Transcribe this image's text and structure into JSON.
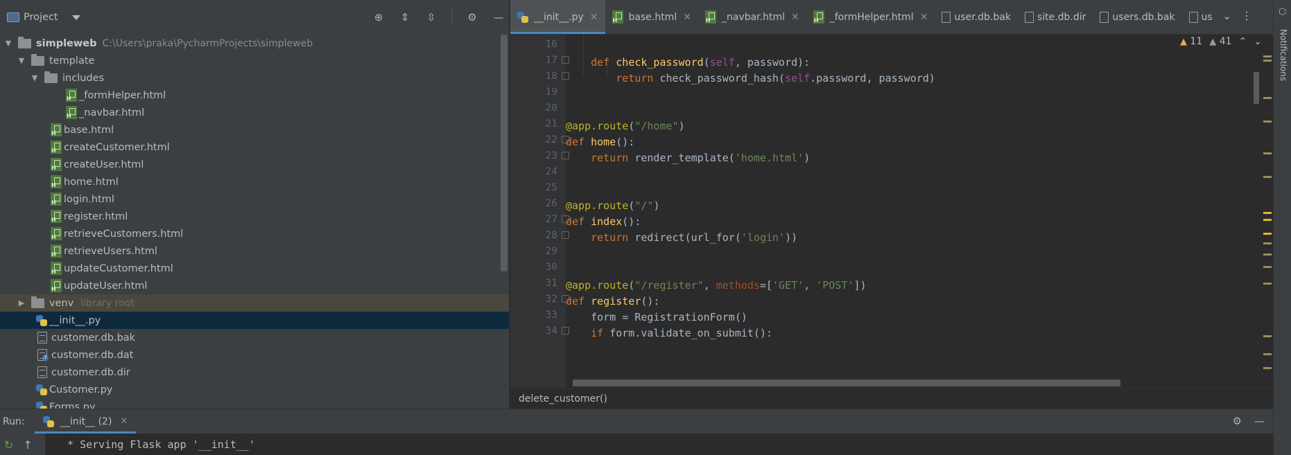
{
  "project": {
    "title": "Project",
    "tree": [
      {
        "label": "simpleweb",
        "hint": "C:\\Users\\praka\\PycharmProjects\\simpleweb"
      },
      {
        "label": "template"
      },
      {
        "label": "includes"
      },
      {
        "label": "_formHelper.html"
      },
      {
        "label": "_navbar.html"
      },
      {
        "label": "base.html"
      },
      {
        "label": "createCustomer.html"
      },
      {
        "label": "createUser.html"
      },
      {
        "label": "home.html"
      },
      {
        "label": "login.html"
      },
      {
        "label": "register.html"
      },
      {
        "label": "retrieveCustomers.html"
      },
      {
        "label": "retrieveUsers.html"
      },
      {
        "label": "updateCustomer.html"
      },
      {
        "label": "updateUser.html"
      },
      {
        "label": "venv",
        "hint": "library root"
      },
      {
        "label": "__init__.py"
      },
      {
        "label": "customer.db.bak"
      },
      {
        "label": "customer.db.dat"
      },
      {
        "label": "customer.db.dir"
      },
      {
        "label": "Customer.py"
      },
      {
        "label": "Forms.py"
      }
    ]
  },
  "tabs": [
    {
      "label": "__init__.py"
    },
    {
      "label": "base.html"
    },
    {
      "label": "_navbar.html"
    },
    {
      "label": "_formHelper.html"
    },
    {
      "label": "user.db.bak"
    },
    {
      "label": "site.db.dir"
    },
    {
      "label": "users.db.bak"
    },
    {
      "label": "us"
    }
  ],
  "inspections": {
    "warnings": "11",
    "weak_warnings": "41"
  },
  "code": {
    "line_numbers": [
      "16",
      "17",
      "18",
      "19",
      "20",
      "21",
      "22",
      "23",
      "24",
      "25",
      "26",
      "27",
      "28",
      "29",
      "30",
      "31",
      "32",
      "33",
      "34"
    ],
    "lines": [
      {
        "t1": ""
      },
      {
        "t1": "    ",
        "kw1": "def ",
        "fn": "check_password",
        "t2": "(",
        "self": "self",
        "t3": ", password):"
      },
      {
        "t1": "        ",
        "kw1": "return ",
        "t2": "check_password_hash(",
        "self": "self",
        "t3": ".password, password)"
      },
      {
        "t1": ""
      },
      {
        "t1": ""
      },
      {
        "dec": "@app.route",
        "t1": "(",
        "str1": "\"/home\"",
        "t2": ")"
      },
      {
        "kw1": "def ",
        "fn": "home",
        "t1": "():"
      },
      {
        "t1": "    ",
        "kw1": "return ",
        "t2": "render_template(",
        "str1": "'home.html'",
        "t3": ")"
      },
      {
        "t1": ""
      },
      {
        "t1": ""
      },
      {
        "dec": "@app.route",
        "t1": "(",
        "str1": "\"/\"",
        "t2": ")"
      },
      {
        "kw1": "def ",
        "fn": "index",
        "t1": "():"
      },
      {
        "t1": "    ",
        "kw1": "return ",
        "t2": "redirect(url_for(",
        "str1": "'login'",
        "t3": "))"
      },
      {
        "t1": ""
      },
      {
        "t1": ""
      },
      {
        "dec": "@app.route",
        "t1": "(",
        "str1": "\"/register\"",
        "t2": ", ",
        "param": "methods",
        "t3": "=[",
        "str2": "'GET'",
        "t4": ", ",
        "str3": "'POST'",
        "t5": "])"
      },
      {
        "kw1": "def ",
        "fn": "register",
        "t1": "():"
      },
      {
        "t1": "    form = RegistrationForm()"
      },
      {
        "t1": "    ",
        "kw1": "if ",
        "t2": "form.validate_on_submit():"
      }
    ]
  },
  "breadcrumb": "delete_customer()",
  "right_strip": {
    "label": "Notifications"
  },
  "run": {
    "label": "Run:",
    "tab": "__init__ (2)",
    "output": " * Serving Flask app '__init__'"
  },
  "colors": {
    "keyword": "#cc7832",
    "function": "#ffc66d",
    "string": "#6a8759",
    "decorator": "#bbb529",
    "self": "#94558d",
    "param": "#aa4926",
    "accent": "#4a88c7",
    "warning": "#e5b13a"
  }
}
